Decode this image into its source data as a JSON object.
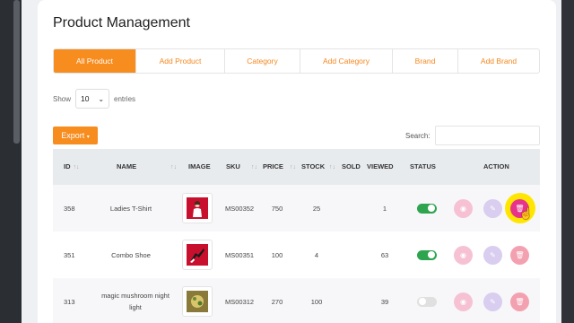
{
  "page_title": "Product Management",
  "tabs": [
    "All Product",
    "Add Product",
    "Category",
    "Add Category",
    "Brand",
    "Add Brand"
  ],
  "length_menu": {
    "show": "Show",
    "value": "10",
    "entries": "entries"
  },
  "export_label": "Export",
  "search_label": "Search:",
  "columns": {
    "id": "ID",
    "name": "NAME",
    "image": "IMAGE",
    "sku": "SKU",
    "price": "PRICE",
    "stock": "STOCK",
    "sold": "SOLD",
    "viewed": "VIEWED",
    "status": "STATUS",
    "action": "ACTION"
  },
  "rows": [
    {
      "id": "358",
      "name": "Ladies T-Shirt",
      "sku": "MS00352",
      "price": "750",
      "stock": "25",
      "sold": "",
      "viewed": "1",
      "status": "on",
      "image_icon": "tshirt-product-image"
    },
    {
      "id": "351",
      "name": "Combo Shoe",
      "sku": "MS00351",
      "price": "100",
      "stock": "4",
      "sold": "",
      "viewed": "63",
      "status": "on",
      "image_icon": "shoe-product-image"
    },
    {
      "id": "313",
      "name": "magic mushroom night light",
      "sku": "MS00312",
      "price": "270",
      "stock": "100",
      "sold": "",
      "viewed": "39",
      "status": "off",
      "image_icon": "night-light-product-image"
    }
  ],
  "colors": {
    "accent": "#f78c1f",
    "toggle_on": "#2ea44f",
    "delete_active": "#e8338a"
  }
}
